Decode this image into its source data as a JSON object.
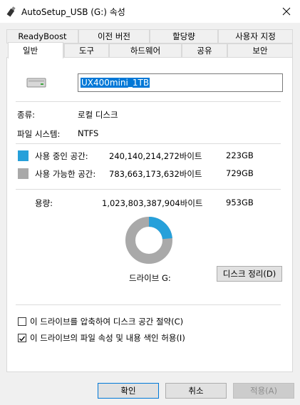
{
  "window": {
    "title": "AutoSetup_USB (G:) 속성",
    "icon": "usb-drive-icon",
    "close_icon": "close-icon"
  },
  "tabs": {
    "row1": [
      "ReadyBoost",
      "이전 버전",
      "할당량",
      "사용자 지정"
    ],
    "row2": [
      "일반",
      "도구",
      "하드웨어",
      "공유",
      "보안"
    ],
    "selected": "일반"
  },
  "general": {
    "volume_name": "UX400mini_1TB",
    "type_label": "종류:",
    "type_value": "로컬 디스크",
    "fs_label": "파일 시스템:",
    "fs_value": "NTFS",
    "used": {
      "label": "사용 중인 공간:",
      "bytes": "240,140,214,272바이트",
      "size": "223GB",
      "color": "#26a0da"
    },
    "free": {
      "label": "사용 가능한 공간:",
      "bytes": "783,663,173,632바이트",
      "size": "729GB",
      "color": "#a9a9a9"
    },
    "capacity": {
      "label": "용량:",
      "bytes": "1,023,803,387,904바이트",
      "size": "953GB"
    },
    "used_fraction": 0.2346,
    "drive_label": "드라이브 G:",
    "cleanup_button": "디스크 정리(D)",
    "compress_checkbox": {
      "label": "이 드라이브를 압축하여 디스크 공간 절약(C)",
      "checked": false
    },
    "index_checkbox": {
      "label": "이 드라이브의 파일 속성 및 내용 색인 허용(I)",
      "checked": true
    }
  },
  "buttons": {
    "ok": "확인",
    "cancel": "취소",
    "apply": "적용(A)"
  }
}
